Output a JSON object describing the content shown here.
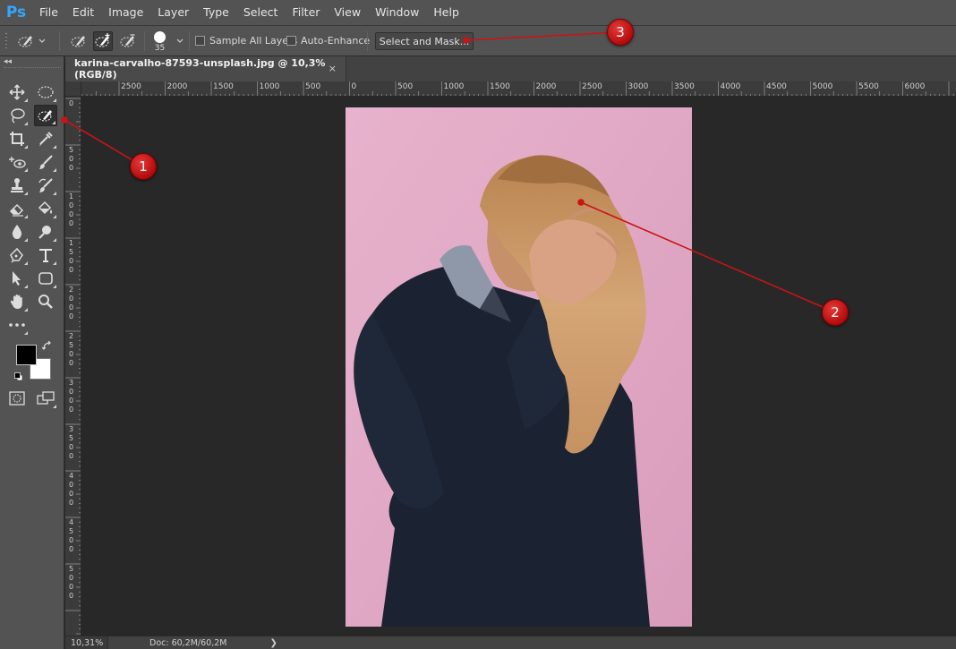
{
  "app": {
    "logo": "Ps"
  },
  "menu": [
    "File",
    "Edit",
    "Image",
    "Layer",
    "Type",
    "Select",
    "Filter",
    "View",
    "Window",
    "Help"
  ],
  "options_bar": {
    "brush_size": "35",
    "sample_all_layers": "Sample All Layers",
    "auto_enhance": "Auto-Enhance",
    "select_and_mask": "Select and Mask..."
  },
  "document": {
    "tab_title": "karina-carvalho-87593-unsplash.jpg @ 10,3% (RGB/8)",
    "close": "×"
  },
  "ruler_h": [
    "2500",
    "2000",
    "1500",
    "1000",
    "500",
    "0",
    "500",
    "1000",
    "1500",
    "2000",
    "2500",
    "3000",
    "3500",
    "4000",
    "4500",
    "5000",
    "5500",
    "6000"
  ],
  "ruler_v": [
    "0",
    "500",
    "1000",
    "1500",
    "2000",
    "2500",
    "3000",
    "3500",
    "4000",
    "4500",
    "5000"
  ],
  "tools_panel": {
    "collapse": "◂◂"
  },
  "status": {
    "zoom": "10,31%",
    "doc": "Doc: 60,2M/60,2M",
    "arrow": "❯"
  },
  "callouts": [
    "1",
    "2",
    "3"
  ],
  "colors": {
    "foreground": "#000000",
    "background": "#ffffff",
    "callout": "#c81414",
    "backdrop": "#e0aac6"
  }
}
